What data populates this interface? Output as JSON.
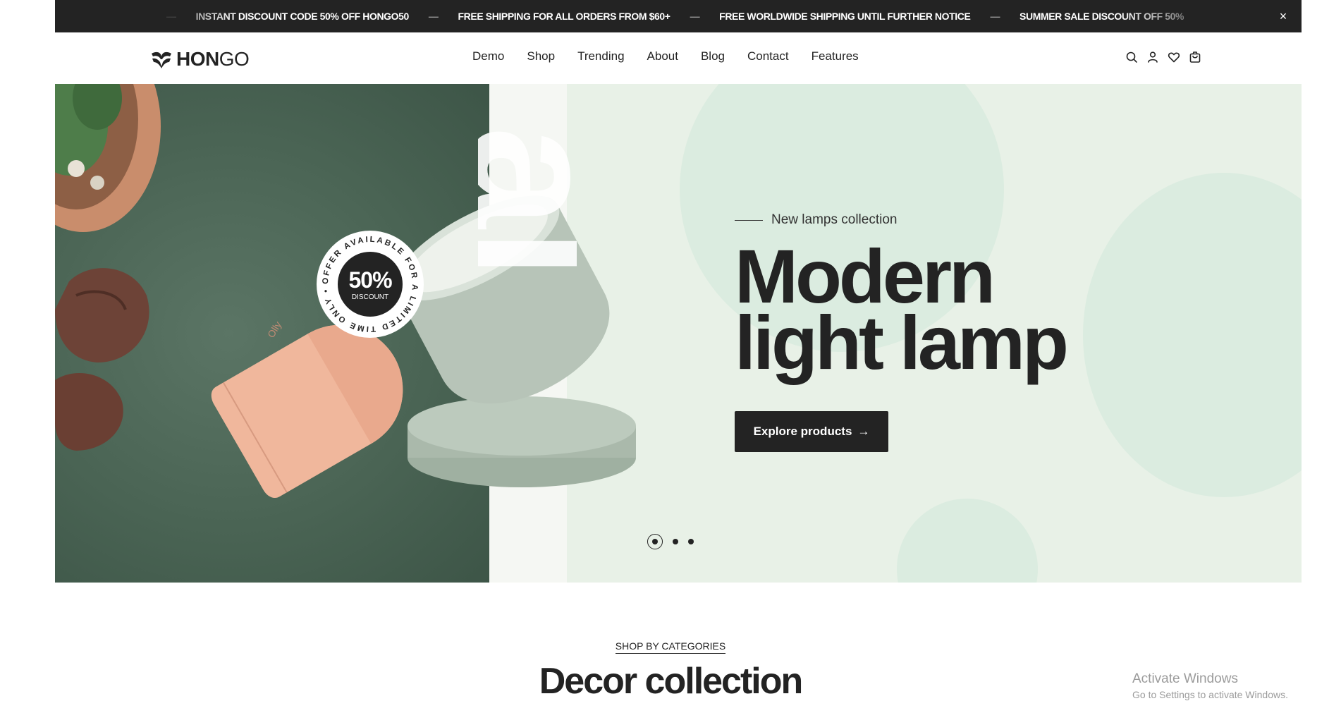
{
  "announcement": {
    "messages": [
      "INSTANT DISCOUNT CODE 50% OFF HONGO50",
      "FREE SHIPPING FOR ALL ORDERS FROM $60+",
      "FREE WORLDWIDE SHIPPING UNTIL FURTHER NOTICE",
      "SUMMER SALE DISCOUNT OFF 50%"
    ],
    "separator": "—",
    "close_label": "×"
  },
  "brand": {
    "bold": "HON",
    "light": "GO"
  },
  "nav": {
    "items": [
      "Demo",
      "Shop",
      "Trending",
      "About",
      "Blog",
      "Contact",
      "Features"
    ]
  },
  "header_icons": [
    "search-icon",
    "user-icon",
    "heart-icon",
    "cart-icon"
  ],
  "hero": {
    "kicker": "New lamps collection",
    "title_line1": "Modern",
    "title_line2": "light lamp",
    "cta_label": "Explore products",
    "cta_arrow": "→",
    "badge": {
      "percent": "50%",
      "label": "DISCOUNT",
      "ring_text": "OFFER AVAILABLE FOR A LIMITED TIME ONLY •"
    },
    "product_brand": "Olly",
    "slides": {
      "count": 3,
      "active": 1
    }
  },
  "categories": {
    "kicker": "SHOP BY CATEGORIES",
    "title": "Decor collection"
  },
  "watermark": {
    "line1": "Activate Windows",
    "line2": "Go to Settings to activate Windows."
  },
  "colors": {
    "dark": "#232323",
    "hero_bg": "#e8f1e7",
    "lamp_green": "#b7c4b8",
    "lamp_pink": "#f0b79c"
  }
}
